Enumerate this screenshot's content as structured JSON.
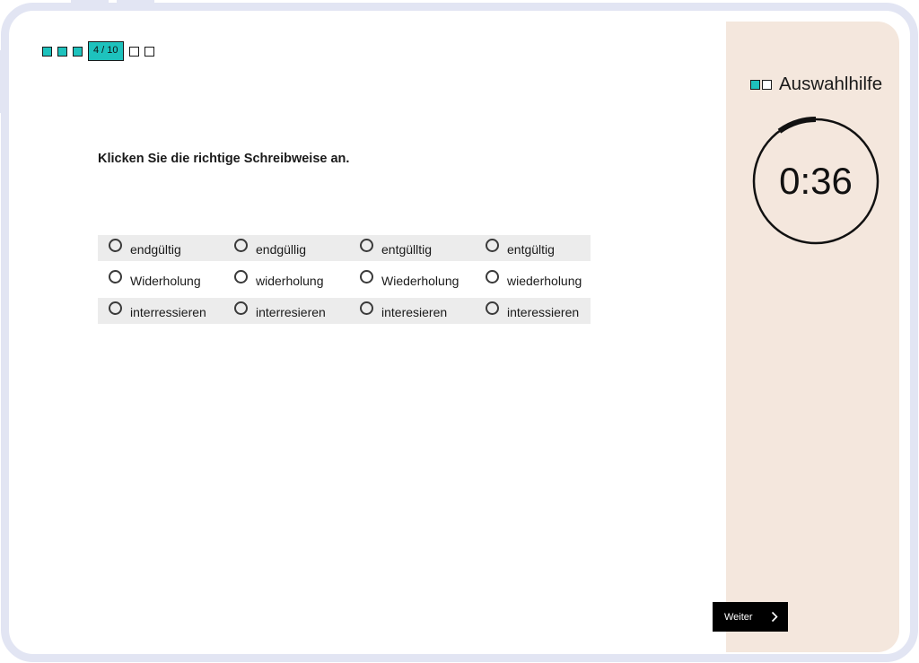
{
  "progress": {
    "completed": 3,
    "current_label": "4 / 10",
    "remaining": 2,
    "accent_color": "#1ec2bd"
  },
  "question": {
    "text": "Klicken Sie die richtige Schreibweise an."
  },
  "options": [
    [
      "endgültig",
      "endgüllig",
      "entgülltig",
      "entgültig"
    ],
    [
      "Widerholung",
      "widerholung",
      "Wiederholung",
      "wiederholung"
    ],
    [
      "interressieren",
      "interresieren",
      "interesieren",
      "interessieren"
    ]
  ],
  "sidebar": {
    "title": "Auswahlhilfe",
    "logo_icon": "two-squares-logo-icon",
    "background_color": "#f4e7dd",
    "timer": {
      "display": "0:36",
      "remaining_seconds": 36,
      "total_seconds": 40,
      "icon": "countdown-ring-icon"
    }
  },
  "navigation": {
    "next_label": "Weiter",
    "next_icon": "chevron-right-icon"
  }
}
